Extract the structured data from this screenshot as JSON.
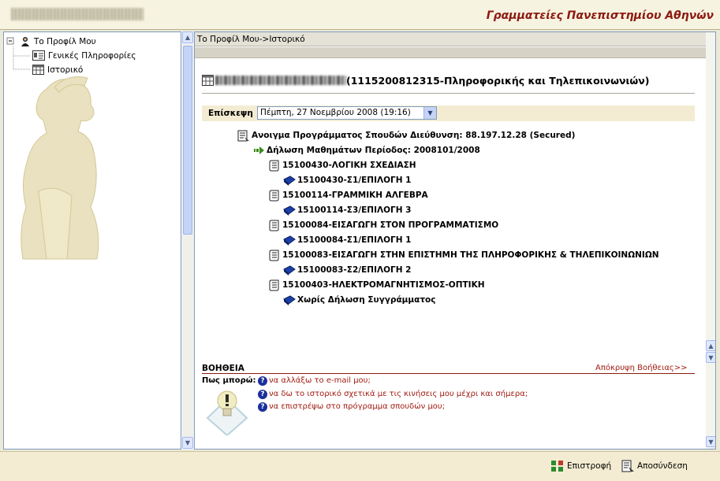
{
  "header": {
    "user_name_blurred": "ΣΠΑΝΑΚΗΣ Α. ΠΑΠΑΚΗ",
    "app_title": "Γραμματείες Πανεπιστημίου Αθηνών"
  },
  "sidebar": {
    "root": "Το Προφίλ Μου",
    "items": [
      {
        "label": "Γενικές Πληροφορίες",
        "icon": "id-card-icon"
      },
      {
        "label": "Ιστορικό",
        "icon": "calendar-icon"
      }
    ]
  },
  "main": {
    "breadcrumb": "Το Προφίλ Μου->Ιστορικό",
    "student_id_text": "(1115200812315-Πληροφορικής και Τηλεπικοινωνιών)",
    "visit_label": "Επίσκεψη",
    "visit_value": "Πέμπτη, 27 Νοεμβρίου 2008 (19:16)",
    "tree": [
      {
        "text": "Ανοιγμα Προγράμματος Σπουδών Διεύθυνση: 88.197.12.28 (Secured)",
        "icon": "document-icon",
        "level": 0
      },
      {
        "text": "Δήλωση Μαθημάτων Περίοδος: 2008101/2008",
        "icon": "green-arrow-icon",
        "level": 1
      },
      {
        "text": "15100430-ΛΟΓΙΚΗ ΣΧΕΔΙΑΣΗ",
        "icon": "scroll-icon",
        "level": 2
      },
      {
        "text": "15100430-Σ1/ΕΠΙΛΟΓΗ 1",
        "icon": "book-icon",
        "level": 3
      },
      {
        "text": "15100114-ΓΡΑΜΜΙΚΗ ΑΛΓΕΒΡΑ",
        "icon": "scroll-icon",
        "level": 2
      },
      {
        "text": "15100114-Σ3/ΕΠΙΛΟΓΗ 3",
        "icon": "book-icon",
        "level": 3
      },
      {
        "text": "15100084-ΕΙΣΑΓΩΓΗ ΣΤΟΝ ΠΡΟΓΡΑΜΜΑΤΙΣΜΟ",
        "icon": "scroll-icon",
        "level": 2
      },
      {
        "text": "15100084-Σ1/ΕΠΙΛΟΓΗ 1",
        "icon": "book-icon",
        "level": 3
      },
      {
        "text": "15100083-ΕΙΣΑΓΩΓΗ ΣΤΗΝ ΕΠΙΣΤΗΜΗ ΤΗΣ ΠΛΗΡΟΦΟΡΙΚΗΣ & ΤΗΛΕΠΙΚΟΙΝΩΝΙΩΝ",
        "icon": "scroll-icon",
        "level": 2
      },
      {
        "text": "15100083-Σ2/ΕΠΙΛΟΓΗ 2",
        "icon": "book-icon",
        "level": 3
      },
      {
        "text": "15100403-ΗΛΕΚΤΡΟΜΑΓΝΗΤΙΣΜΟΣ-ΟΠΤΙΚΗ",
        "icon": "scroll-icon",
        "level": 2
      },
      {
        "text": "Χωρίς Δήλωση Συγγράμματος",
        "icon": "book-icon",
        "level": 3
      }
    ]
  },
  "help": {
    "title": "ΒΟΗΘΕΙΑ",
    "hide": "Απόκρυψη Βοήθειας>>",
    "question": "Πως μπορώ:",
    "links": [
      "να αλλάξω το e-mail μου;",
      "να δω το ιστορικό σχετικά με τις κινήσεις μου μέχρι και σήμερα;",
      "να επιστρέψω στο πρόγραμμα σπουδών μου;"
    ]
  },
  "footer": {
    "back": "Επιστροφή",
    "logout": "Αποσύνδεση"
  },
  "colors": {
    "accent_red": "#8b1a10",
    "link_red": "#a11c12",
    "header_bg": "#f7f3e1",
    "bar_bg": "#f3ecd2"
  }
}
